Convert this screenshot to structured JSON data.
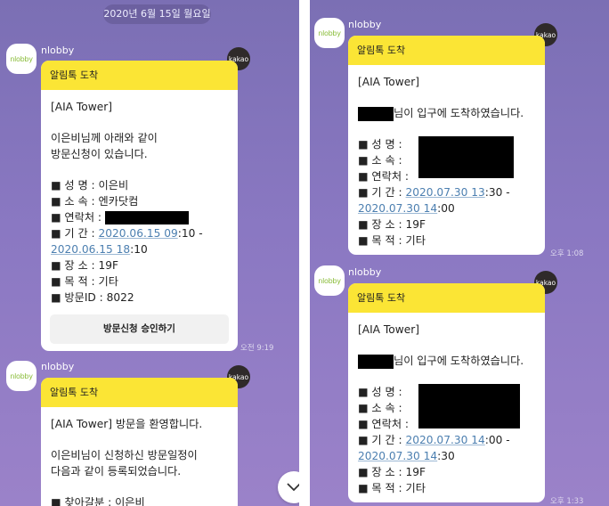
{
  "left": {
    "date": "2020년 6월 15일 월요일",
    "messages": [
      {
        "sender": "nlobby",
        "avatar_text": "nlobby",
        "badge": "kakao",
        "header": "알림톡 도착",
        "lines": {
          "l1": "[AIA Tower]",
          "l2": "이은비님께 아래와 같이",
          "l3": "방문신청이 있습니다.",
          "name": "■ 성  명 : 이은비",
          "org": "■ 소  속 : 엔카닷컴",
          "contact": "■ 연락처 : ",
          "period_prefix": "■ 기  간 : ",
          "period_start_link": "2020.06.15 09",
          "period_start_rest": ":10 -",
          "period_end_link": "2020.06.15 18",
          "period_end_rest": ":10",
          "place": "■ 장  소 : 19F",
          "purpose": "■ 목  적 : 기타",
          "visit_id": "■ 방문ID : 8022"
        },
        "button": "방문신청 승인하기",
        "time": "오전 9:19"
      },
      {
        "sender": "nlobby",
        "avatar_text": "nlobby",
        "badge": "kakao",
        "header": "알림톡 도착",
        "lines": {
          "l1": "[AIA Tower] 방문을 환영합니다.",
          "l2": "이은비님이 신청하신 방문일정이",
          "l3": "다음과 같이 등록되었습니다.",
          "l4": "■ 찾아갈분 : 이은비"
        }
      }
    ]
  },
  "right": {
    "messages": [
      {
        "sender": "nlobby",
        "avatar_text": "nlobby",
        "badge": "kakao",
        "header": "알림톡 도착",
        "lines": {
          "l1": "[AIA Tower]",
          "arrival": "님이 입구에 도착하였습니다.",
          "name": "■ 성  명 :",
          "org": "■ 소  속 :",
          "contact": "■ 연락처 :",
          "period_prefix": "■ 기  간 : ",
          "period_start_link": "2020.07.30 13",
          "period_start_rest": ":30 -",
          "period_end_link": "2020.07.30 14",
          "period_end_rest": ":00",
          "place": "■ 장  소 : 19F",
          "purpose": "■ 목  적 : 기타"
        },
        "time": "오후 1:08"
      },
      {
        "sender": "nlobby",
        "avatar_text": "nlobby",
        "badge": "kakao",
        "header": "알림톡 도착",
        "lines": {
          "l1": "[AIA Tower]",
          "arrival": "님이 입구에 도착하였습니다.",
          "name": "■ 성  명 :",
          "org": "■ 소  속 :",
          "contact": "■ 연락처 :",
          "period_prefix": "■ 기  간 : ",
          "period_start_link": "2020.07.30 14",
          "period_start_rest": ":00 -",
          "period_end_link": "2020.07.30 14",
          "period_end_rest": ":30",
          "place": "■ 장  소 : 19F",
          "purpose": "■ 목  적 : 기타"
        },
        "time": "오후 1:33"
      }
    ]
  },
  "icons": {
    "scroll_down": "chevron-down-icon"
  }
}
